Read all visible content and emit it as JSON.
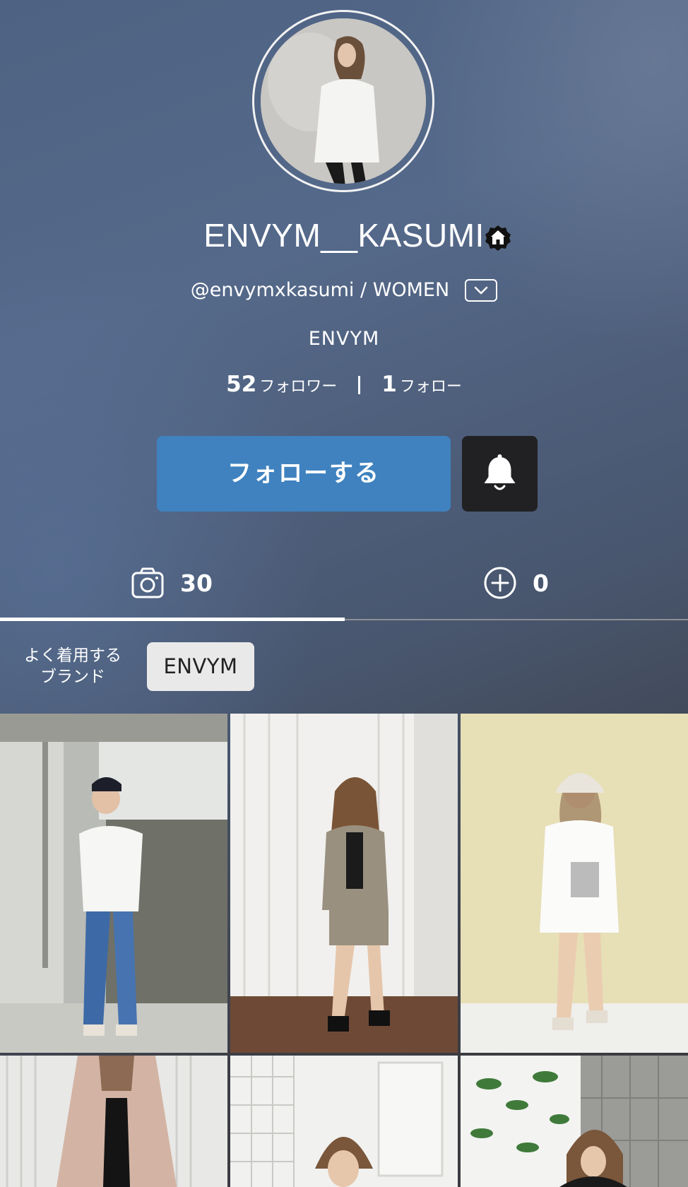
{
  "profile": {
    "display_name": "ENVYM__KASUMI",
    "handle": "@envymxkasumi / WOMEN",
    "brand": "ENVYM",
    "followers_count": "52",
    "followers_label": "フォロワー",
    "following_count": "1",
    "following_label": "フォロー"
  },
  "actions": {
    "follow_label": "フォローする"
  },
  "tabs": {
    "posts_count": "30",
    "other_count": "0"
  },
  "frequent_brands": {
    "label_line1": "よく着用する",
    "label_line2": "ブランド",
    "chips": [
      "ENVYM"
    ]
  },
  "icons": {
    "badge": "home-badge-icon",
    "dropdown": "chevron-down-icon",
    "bell": "bell-icon",
    "posts": "camera-icon",
    "other": "plus-circle-icon"
  },
  "colors": {
    "follow_button": "#3f82bf",
    "bell_button": "#212123",
    "chip_background": "#e9e9ea"
  }
}
